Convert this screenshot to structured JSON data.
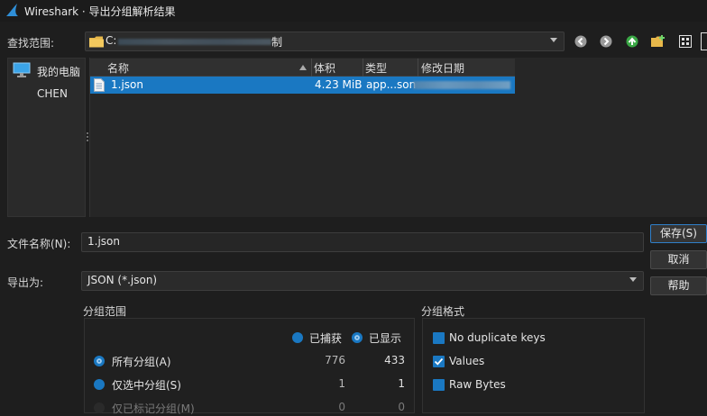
{
  "window": {
    "title": "Wireshark · 导出分组解析结果"
  },
  "location": {
    "label": "查找范围:",
    "path": "C:",
    "path_tail": "制"
  },
  "sidebar": {
    "items": [
      {
        "label": "我的电脑"
      },
      {
        "label": "CHEN"
      }
    ]
  },
  "file_list": {
    "columns": {
      "name": "名称",
      "size": "体积",
      "type": "类型",
      "modified": "修改日期"
    },
    "rows": [
      {
        "name": "1.json",
        "size": "4.23 MiB",
        "type": "app...son"
      }
    ]
  },
  "filename": {
    "label": "文件名称(N):",
    "value": "1.json"
  },
  "export_as": {
    "label": "导出为:",
    "value": "JSON (*.json)"
  },
  "buttons": {
    "save": "保存(S)",
    "cancel": "取消",
    "help": "帮助"
  },
  "packet_range": {
    "title": "分组范围",
    "col_captured": "已捕获",
    "col_displayed": "已显示",
    "rows": [
      {
        "label": "所有分组(A)",
        "captured": "776",
        "displayed": "433",
        "selected": true,
        "enabled": true
      },
      {
        "label": "仅选中分组(S)",
        "captured": "1",
        "displayed": "1",
        "selected": false,
        "enabled": true
      },
      {
        "label": "仅已标记分组(M)",
        "captured": "0",
        "displayed": "0",
        "selected": false,
        "enabled": false
      }
    ]
  },
  "packet_format": {
    "title": "分组格式",
    "options": [
      {
        "label": "No duplicate keys",
        "checked": false
      },
      {
        "label": "Values",
        "checked": true
      },
      {
        "label": "Raw Bytes",
        "checked": false
      }
    ]
  },
  "colors": {
    "accent": "#1a78c2",
    "background": "#1e1e1e"
  }
}
